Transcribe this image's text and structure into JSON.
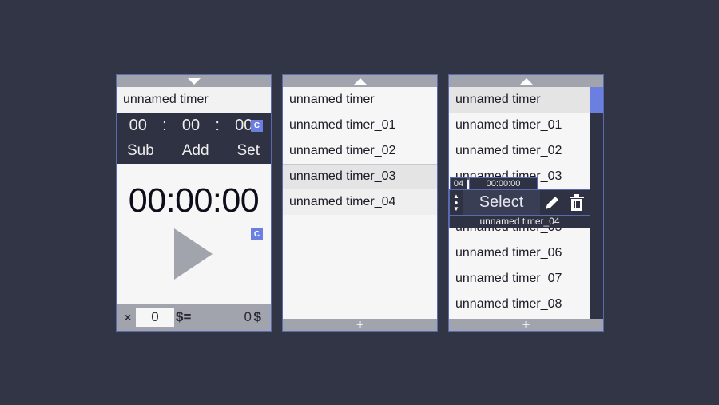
{
  "left": {
    "name": "unnamed timer",
    "h": "00",
    "m": "00",
    "s": "00",
    "sep": ":",
    "clear_label": "C",
    "sub": "Sub",
    "add": "Add",
    "set": "Set",
    "display": "00:00:00",
    "clear2_label": "C",
    "mult_symbol": "×",
    "rate_value": "0",
    "rate_unit": "$=",
    "total": "0",
    "total_unit": "$"
  },
  "middle": {
    "items": [
      "unnamed timer",
      "unnamed timer_01",
      "unnamed timer_02",
      "unnamed timer_03",
      "unnamed timer_04"
    ]
  },
  "right": {
    "items": [
      "unnamed timer",
      "unnamed timer_01",
      "unnamed timer_02",
      "unnamed timer_03",
      "",
      "unnamed timer_05",
      "unnamed timer_06",
      "unnamed timer_07",
      "unnamed timer_08"
    ],
    "popup": {
      "index": "04",
      "time": "00:00:00",
      "select_label": "Select",
      "name": "unnamed timer_04"
    }
  },
  "colors": {
    "accent": "#6a7fe0",
    "dark": "#2f3242",
    "background": "#323545"
  }
}
